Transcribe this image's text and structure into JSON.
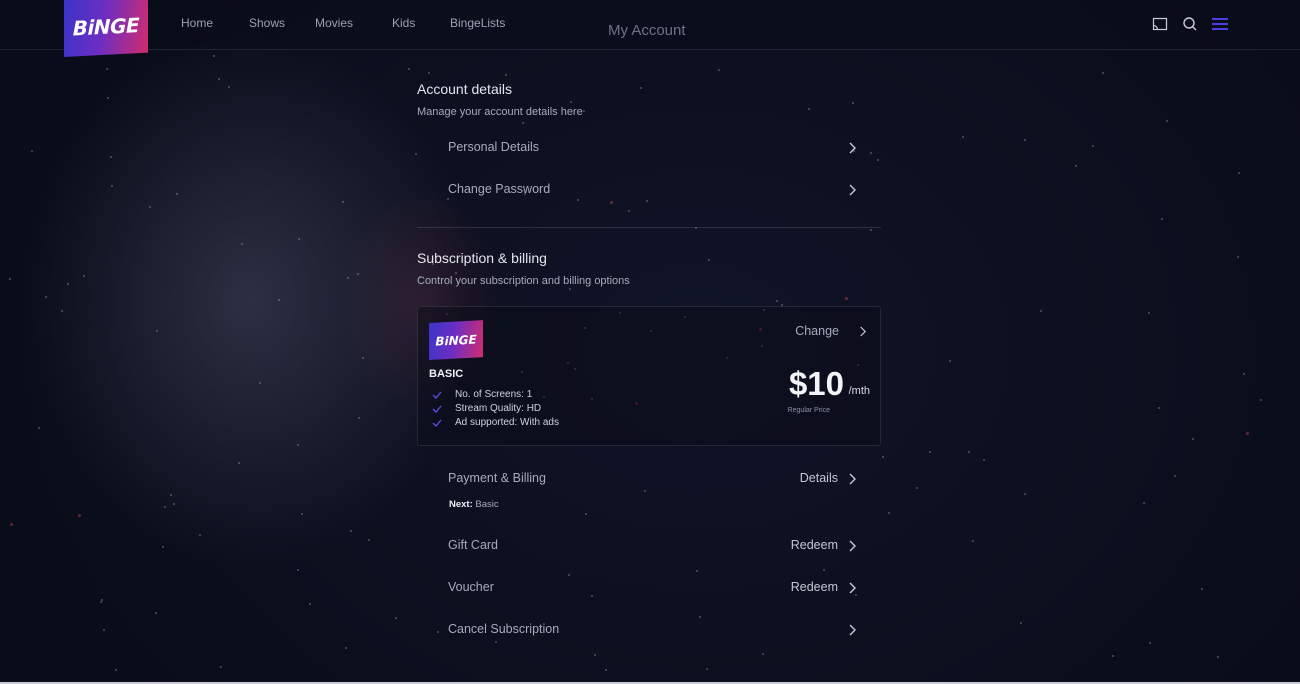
{
  "app": {
    "logo_text": "BiNGE",
    "page_title": "My Account",
    "accent_color": "#4b3fe0",
    "brand_gradient": [
      "#3b34c8",
      "#6a2ec4",
      "#d12c6e"
    ]
  },
  "nav": {
    "items": [
      {
        "label": "Home"
      },
      {
        "label": "Shows"
      },
      {
        "label": "Movies"
      },
      {
        "label": "Kids"
      },
      {
        "label": "BingeLists"
      }
    ],
    "icons": [
      "cast-icon",
      "search-icon",
      "menu-icon"
    ]
  },
  "account_details": {
    "title": "Account details",
    "subtitle": "Manage your account details here",
    "rows": [
      {
        "label": "Personal Details",
        "action": ""
      },
      {
        "label": "Change Password",
        "action": ""
      }
    ]
  },
  "subscription": {
    "title": "Subscription & billing",
    "subtitle": "Control your subscription and billing options",
    "plan": {
      "logo_text": "BiNGE",
      "name": "BASIC",
      "features": [
        "No. of Screens: 1",
        "Stream Quality: HD",
        "Ad supported: With ads"
      ],
      "change_label": "Change",
      "price": "$10",
      "period": "/mth",
      "price_note": "Regular Price"
    },
    "rows": [
      {
        "label": "Payment & Billing",
        "action": "Details"
      },
      {
        "label": "Gift Card",
        "action": "Redeem"
      },
      {
        "label": "Voucher",
        "action": "Redeem"
      },
      {
        "label": "Cancel Subscription",
        "action": ""
      }
    ],
    "next_label": "Next:",
    "next_value": "Basic"
  }
}
